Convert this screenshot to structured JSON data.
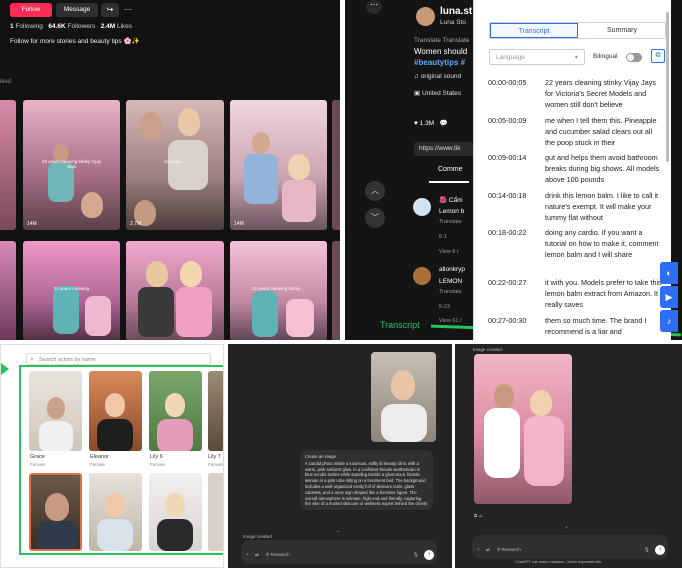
{
  "tiktok": {
    "follow_label": "Follow",
    "message_label": "Message",
    "following_count": "1",
    "following_label": "Following",
    "followers_count": "64.6K",
    "followers_label": "Followers",
    "likes_count": "2.4M",
    "likes_label": "Likes",
    "bio": "Follow for more stories and beauty tips 🌸✨",
    "section_label": "iked",
    "thumbs": [
      {
        "caption": "22 years cleaning stinky Vijay Jays",
        "views": "14M"
      },
      {
        "caption": "13 years ... ",
        "views": "2.7M"
      },
      {
        "caption": "",
        "views": "14M"
      },
      {
        "caption": "22 years cleaning",
        "views": ""
      },
      {
        "caption": "22 years cleaning stinky ...",
        "views": ""
      },
      {
        "caption": "",
        "views": ""
      }
    ]
  },
  "player": {
    "username": "luna.st",
    "subtitle": "Luna Sto",
    "translate": "Translate Translate",
    "description": "Women should",
    "tags": "#beautytips #",
    "sound": "original sound",
    "location": "United States",
    "likes": "1.3M",
    "url": "https://www.tik",
    "comments_tab": "Comme",
    "comments": [
      {
        "name": "🌺 Cẩm",
        "text": "Lemon b",
        "meta": "Translate",
        "replies": "6-1",
        "view": "View 6 r"
      },
      {
        "name": "alionkryp",
        "text": "LEMON",
        "meta": "Translate",
        "replies": "5-23",
        "view": "View 61 r"
      }
    ],
    "transcript_label": "Transcript"
  },
  "transcript": {
    "tab_transcript": "Transcript",
    "tab_summary": "Summary",
    "language_placeholder": "Language",
    "bilingual": "Bilingual",
    "segments": [
      {
        "time": "00:00-00:05",
        "text": "22 years cleaning stinky Vijay Jays for Victoria's Secret Models and women still don't believe"
      },
      {
        "time": "00:05-00:09",
        "text": "me when I tell them this. Pineapple and cucumber salad clears out all the poop stuck in their"
      },
      {
        "time": "00:09-00:14",
        "text": "gut and helps them avoid bathroom breaks during big shows. All models above 100 pounds"
      },
      {
        "time": "00:14-00:18",
        "text": "drink this lemon balm. I like to call it nature's exempt. It will make your tummy flat without"
      },
      {
        "time": "00:18-00:22",
        "text": "doing any cardio. If you want a tutorial on how to make it, comment lemon balm and I will share"
      },
      {
        "time": "00:22-00:27",
        "text": "it with you. Models prefer to take this lemon balm extract from Amazon. It really saves"
      },
      {
        "time": "00:27-00:30",
        "text": "them so much time. The brand I recommend is a liar and"
      }
    ]
  },
  "avatars": {
    "search_placeholder": "Search actors by name",
    "cards": [
      {
        "name": "Grace",
        "sub": "Female"
      },
      {
        "name": "Eleanor",
        "sub": "Female"
      },
      {
        "name": "Lily 6",
        "sub": "Female"
      },
      {
        "name": "Lily 7",
        "sub": "Female"
      }
    ]
  },
  "chat1": {
    "title": "Create an image",
    "prompt": "A candid photo inside a luxurious, softly lit beauty clinic with a warm, pink ambient glow. In a confident female aesthetician in blue scrubs smiles while standing beside a glamorous, blonde woman in a pink robe sitting on a treatment bed. The background includes a well-organized vanity full of skincare tools, glass cabinets, and a neon sign shaped like a feminine figure. The overall atmosphere is intimate, high-end and friendly, capturing the vibe of a trusted skincare or wellness expert behind the clients",
    "status": "Image created",
    "tool_label": "Research"
  },
  "chat2": {
    "status": "Image created",
    "tool_label": "Research",
    "disclaimer": "ChatGPT can make mistakes. Check important info."
  }
}
